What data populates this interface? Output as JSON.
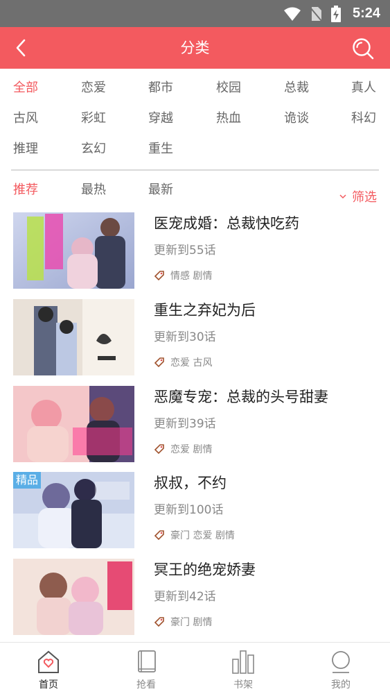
{
  "status_bar": {
    "time": "5:24"
  },
  "header": {
    "title": "分类"
  },
  "categories": [
    [
      "全部",
      "恋爱",
      "都市",
      "校园",
      "总裁",
      "真人"
    ],
    [
      "古风",
      "彩虹",
      "穿越",
      "热血",
      "诡谈",
      "科幻"
    ],
    [
      "推理",
      "玄幻",
      "重生"
    ]
  ],
  "active_category": "全部",
  "sort_tabs": [
    "推荐",
    "最热",
    "最新"
  ],
  "active_sort": "推荐",
  "filter_label": "筛选",
  "comics": [
    {
      "title": "医宠成婚：总裁快吃药",
      "update": "更新到55话",
      "tags": "情感 剧情",
      "badge": ""
    },
    {
      "title": "重生之弃妃为后",
      "update": "更新到30话",
      "tags": "恋爱 古风",
      "badge": ""
    },
    {
      "title": "恶魔专宠：总裁的头号甜妻",
      "update": "更新到39话",
      "tags": "恋爱 剧情",
      "badge": ""
    },
    {
      "title": "叔叔，不约",
      "update": "更新到100话",
      "tags": "豪门 恋爱 剧情",
      "badge": "精品"
    },
    {
      "title": "冥王的绝宠娇妻",
      "update": "更新到42话",
      "tags": "豪门 剧情",
      "badge": ""
    }
  ],
  "bottom_nav": [
    {
      "label": "首页",
      "icon": "home-heart-icon",
      "active": true
    },
    {
      "label": "抢看",
      "icon": "book-icon",
      "active": false
    },
    {
      "label": "书架",
      "icon": "bookshelf-icon",
      "active": false
    },
    {
      "label": "我的",
      "icon": "profile-icon",
      "active": false
    }
  ],
  "colors": {
    "accent": "#f35a5f",
    "status_bar": "#6f6f6f",
    "badge": "#5aaee6"
  }
}
